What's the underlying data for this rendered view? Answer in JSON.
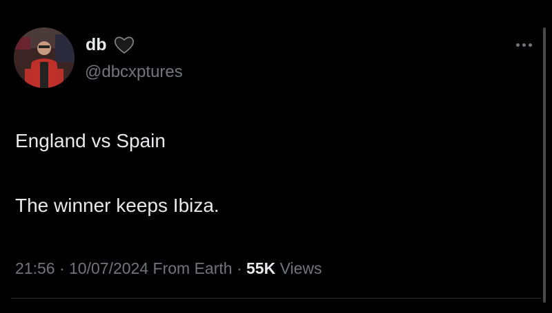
{
  "author": {
    "display_name": "db",
    "handle": "@dbcxptures",
    "badge_icon": "black-heart-icon",
    "avatar_icon": "profile-photo"
  },
  "tweet": {
    "line1": "England vs Spain",
    "line2": "The winner keeps Ibiza."
  },
  "meta": {
    "time": "21:56",
    "separator": "·",
    "date": "10/07/2024",
    "source": "From Earth",
    "views_count": "55K",
    "views_label": "Views"
  },
  "colors": {
    "background": "#000000",
    "primary_text": "#e7e9ea",
    "secondary_text": "#71767b"
  }
}
